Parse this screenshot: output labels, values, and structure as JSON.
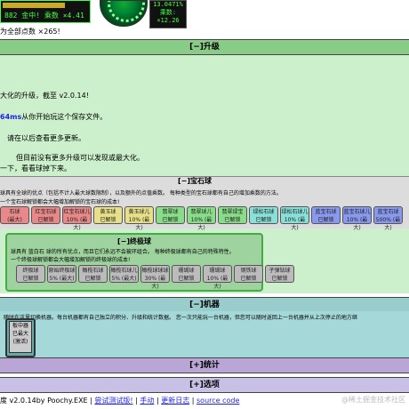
{
  "topbar": {
    "score_text": "882 金中! 乘数 ×4.41",
    "stats_lines": [
      "13.0471%",
      "乘数:",
      "×12.26"
    ],
    "left_note": "为全部点数 ×265!"
  },
  "sections": {
    "upgrades_header": "[−]升级",
    "machines_header": "[−]机器",
    "stats_header": "[+]统计",
    "options_header": "[+]选项"
  },
  "upgrades": {
    "line1": "大化的升级，截至 v2.0.14!",
    "line2_highlight": "64ms",
    "line2_rest": "从你开始玩这个保存文件。",
    "line3": "请在以后查看更多更新。",
    "line4": "但目前没有更多升级可以发现或最大化。",
    "line5": "一下，看看球掉下来。"
  },
  "gem_balls": {
    "title": "[−]宝石球",
    "desc1": "球具有全球的优点（包括不计入最大球数限制），以及额外的点值乘数。 每种类型的宝石球都有自己的增加乘数的方法。",
    "desc2": "一个宝石球解锁都会大幅增加解锁的宝石球的成本!",
    "chips": [
      {
        "name": "石球",
        "sub": "(最大)",
        "color": "#e88888"
      },
      {
        "name": "红宝石球",
        "sub": "已解锁",
        "color": "#e88888"
      },
      {
        "name": "红宝石球儿",
        "sub": "10% (最大)",
        "color": "#e88888"
      },
      {
        "name": "黄玉球",
        "sub": "已解锁",
        "color": "#e8e088"
      },
      {
        "name": "黄玉球儿",
        "sub": "10% (最大)",
        "color": "#e8e088"
      },
      {
        "name": "翡翠球",
        "sub": "已解锁",
        "color": "#88dd88"
      },
      {
        "name": "翡翠球儿",
        "sub": "10% (最大)",
        "color": "#88dd88"
      },
      {
        "name": "翡翠绿宝",
        "sub": "已解锁",
        "color": "#88dd88"
      },
      {
        "name": "绿松石球",
        "sub": "已解锁",
        "color": "#88e0d8"
      },
      {
        "name": "绿松石球儿",
        "sub": "10% (最大)",
        "color": "#88e0d8"
      },
      {
        "name": "蓝宝石球",
        "sub": "已解锁",
        "color": "#8899ee"
      },
      {
        "name": "蓝宝石球儿",
        "sub": "10% (最大)",
        "color": "#8899ee"
      },
      {
        "name": "蓝宝石球",
        "sub": "500% (最大)",
        "color": "#8899ee"
      }
    ]
  },
  "ultimate": {
    "title": "[−]终极球",
    "desc1": "球具有 蓝白石 球的所有优点，而且它们永远不会被环组合。 每种终极球都有自己的特殊特性。",
    "desc2": "一个终极球解锁都会大幅增加解锁的终极球的成本!",
    "chips": [
      {
        "name": "终极球",
        "sub": "已解锁"
      },
      {
        "name": "原始终极球",
        "sub": "5% (最大)"
      },
      {
        "name": "橄榄石球",
        "sub": "已解锁"
      },
      {
        "name": "橄榄石球儿",
        "sub": "5% (最大)"
      },
      {
        "name": "橄榄球球球",
        "sub": "30% (最大)"
      },
      {
        "name": "珊瑚球",
        "sub": "已解锁"
      },
      {
        "name": "珊瑚球",
        "sub": "10% (最大)"
      },
      {
        "name": "钢铁球",
        "sub": "已解锁"
      },
      {
        "name": "子弹钻球",
        "sub": "已解锁"
      }
    ]
  },
  "machines": {
    "desc": "随时在这里切换机器。每台机器都有自己独立的积分、升级和统计数据。 您一次只能玩一台机器，但您可以随时返回上一台机器并从上次停止的地方继",
    "chip_label": "板中器",
    "chip_sub": "已最大",
    "chip_sub2": "(激活)"
  },
  "footer": {
    "prefix": "度 v2.0.14by Poochy.EXE |",
    "link_test": "尝试测试版!",
    "sep1": "|",
    "link_manual": "手动",
    "sep2": "|",
    "link_changelog": "更新日志",
    "sep3": "|",
    "link_source": "source code",
    "watermark": "@稀土掘金技术社区"
  }
}
